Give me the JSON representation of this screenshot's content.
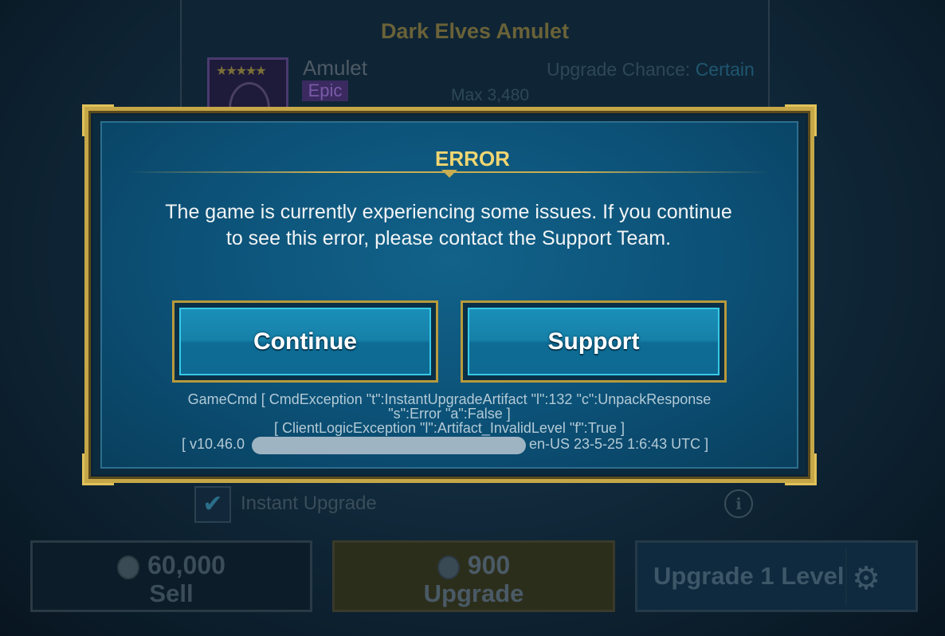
{
  "background": {
    "panel_title": "Dark Elves Amulet",
    "item_name": "Amulet",
    "item_rarity": "Epic",
    "upgrade_chance_label": "Upgrade Chance:",
    "upgrade_chance_value": "Certain",
    "max_label": "Max 3,480",
    "instant_upgrade_label": "Instant Upgrade",
    "instant_upgrade_checked": true,
    "info_icon": "i",
    "sell": {
      "amount": "60,000",
      "label": "Sell"
    },
    "upgrade": {
      "amount": "900",
      "label": "Upgrade"
    },
    "upgrade_level_label": "Upgrade 1 Level",
    "stars": "★★★★★",
    "gear_icon": "⚙"
  },
  "dialog": {
    "title": "ERROR",
    "message": "The game is currently experiencing some issues. If you continue to see this error, please contact the Support Team.",
    "continue_label": "Continue",
    "support_label": "Support",
    "debug_line1": "GameCmd [ CmdException \"t\":InstantUpgradeArtifact \"l\":132 \"c\":UnpackResponse",
    "debug_line2": "\"s\":Error \"a\":False ]",
    "debug_line3": "[ ClientLogicException \"l\":Artifact_InvalidLevel \"f\":True ]",
    "version_left": "[ v10.46.0",
    "version_right": "en-US  23-5-25 1:6:43 UTC ]"
  },
  "colors": {
    "accent_gold": "#c5a748",
    "title_gold": "#f0d672",
    "button_blue": "#1680a8",
    "dialog_blue": "#0c5177"
  }
}
